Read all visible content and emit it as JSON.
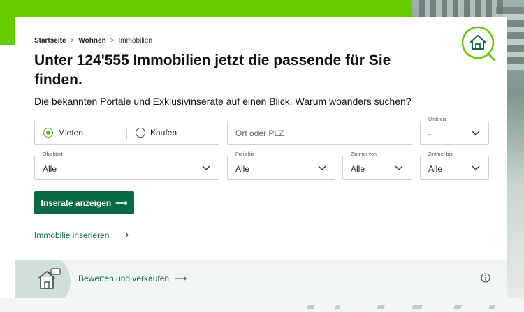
{
  "breadcrumb": {
    "items": [
      "Startseite",
      "Wohnen",
      "Immobilien"
    ],
    "separator": ">"
  },
  "header": {
    "title": "Unter 124'555 Immobilien jetzt die passende für Sie finden.",
    "subtitle": "Die bekannten Portale und Exklusivinserate auf einen Blick. Warum woanders suchen?"
  },
  "search": {
    "mode_options": [
      "Mieten",
      "Kaufen"
    ],
    "mode_selected": "Mieten",
    "location_placeholder": "Ort oder PLZ",
    "umkreis": {
      "label": "Umkreis",
      "value": "-"
    },
    "objektart": {
      "label": "Objektart",
      "value": "Alle"
    },
    "preis_bis": {
      "label": "Preis bis",
      "value": "Alle"
    },
    "zimmer_von": {
      "label": "Zimmer von",
      "value": "Alle"
    },
    "zimmer_bis": {
      "label": "Zimmer bis",
      "value": "Alle"
    },
    "submit_label": "Inserate anzeigen",
    "arrow": "⟶"
  },
  "links": {
    "insert_label": "Immobilie inserieren",
    "arrow": "⟶"
  },
  "bottom_bar": {
    "link_label": "Bewerten und verkaufen",
    "arrow": "⟶",
    "info_icon": "info-icon",
    "house_icon": "house-tag-icon"
  },
  "colors": {
    "brand_green": "#66cc00",
    "primary": "#0b6b45",
    "radio_on": "#55b81e",
    "bottom_bar_bg": "#f1f5f3"
  }
}
